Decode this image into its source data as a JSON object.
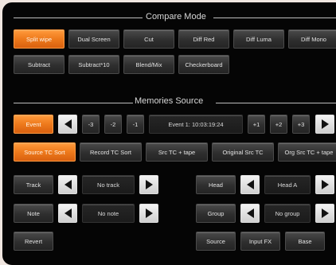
{
  "compare_mode": {
    "title": "Compare Mode",
    "row1": [
      "Split wipe",
      "Dual Screen",
      "Cut",
      "Diff Red",
      "Diff Luma",
      "Diff Mono"
    ],
    "row2": [
      "Subtract",
      "Subtract*10",
      "Blend/Mix",
      "Checkerboard"
    ],
    "active": "Split wipe"
  },
  "memories_source": {
    "title": "Memories Source",
    "event_label": "Event",
    "minus": [
      "-3",
      "-2",
      "-1"
    ],
    "event_display": "Event 1: 10:03:19:24",
    "plus": [
      "+1",
      "+2",
      "+3"
    ],
    "sort_buttons": [
      "Source TC Sort",
      "Record TC Sort",
      "Src TC + tape",
      "Original Src TC",
      "Org Src TC + tape"
    ],
    "active_sort": "Source TC Sort",
    "track_label": "Track",
    "track_value": "No track",
    "note_label": "Note",
    "note_value": "No note",
    "head_label": "Head",
    "head_value": "Head A",
    "group_label": "Group",
    "group_value": "No group",
    "revert_label": "Revert",
    "bottom_buttons": [
      "Source",
      "Input FX",
      "Base"
    ]
  },
  "colors": {
    "accent": "#ee7a1c",
    "background": "#050505"
  }
}
